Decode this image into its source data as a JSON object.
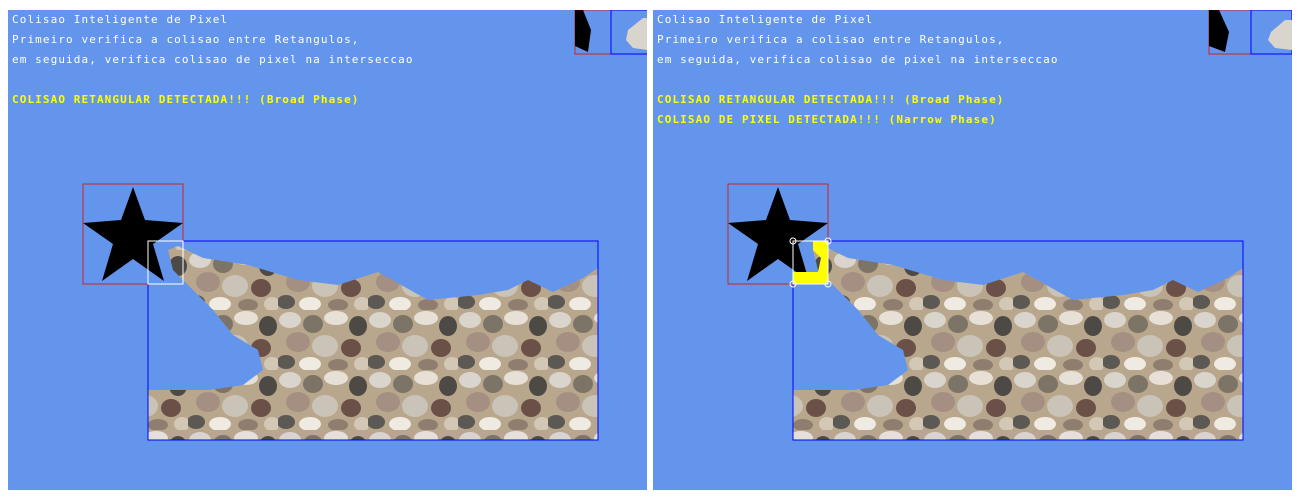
{
  "colors": {
    "background": "#6495ED",
    "hud_text": "#ffffff",
    "alert_text": "#ffff00",
    "star_bbox": "#cc2222",
    "rock_bbox": "#0000ff",
    "intersection": "#ffffff",
    "pixel_overlap": "#ffff00"
  },
  "left": {
    "title": "Colisao Inteligente de Pixel",
    "line1": "Primeiro verifica a colisao entre Retangulos,",
    "line2": "em seguida, verifica colisao de pixel na interseccao",
    "broad_phase": "COLISAO RETANGULAR DETECTADA!!! (Broad Phase)"
  },
  "right": {
    "title": "Colisao Inteligente de Pixel",
    "line1": "Primeiro verifica a colisao entre Retangulos,",
    "line2": "em seguida, verifica colisao de pixel na interseccao",
    "broad_phase": "COLISAO RETANGULAR DETECTADA!!! (Broad Phase)",
    "narrow_phase": "COLISAO DE PIXEL DETECTADA!!! (Narrow Phase)"
  },
  "sprites": {
    "player": "star-icon",
    "obstacle": "rock-terrain"
  }
}
